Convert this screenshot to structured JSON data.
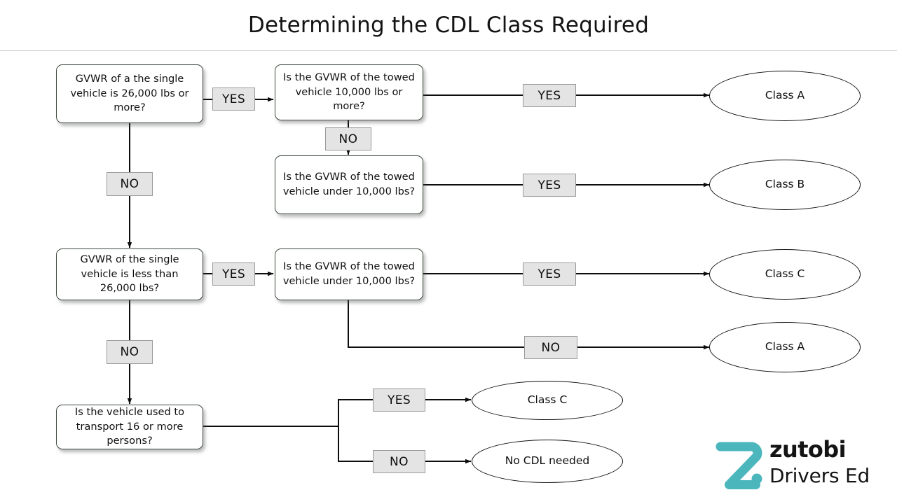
{
  "page": {
    "title": "Determining the CDL Class Required"
  },
  "nodes": {
    "q1": "GVWR of a the single vehicle is 26,000 lbs or more?",
    "q2": "Is the GVWR of the towed vehicle 10,000 lbs or more?",
    "q3": "Is the GVWR of the towed vehicle under 10,000 lbs?",
    "q4": "GVWR of the single vehicle is less than 26,000 lbs?",
    "q5": "Is the GVWR of the towed vehicle under 10,000 lbs?",
    "q6": "Is the vehicle used to transport 16 or more persons?"
  },
  "results": {
    "r1": "Class A",
    "r2": "Class B",
    "r3": "Class C",
    "r4": "Class A",
    "r5": "Class C",
    "r6": "No CDL needed"
  },
  "edges": {
    "yes1": "YES",
    "no1": "NO",
    "yes2": "YES",
    "no2": "NO",
    "yes3": "YES",
    "yes4": "YES",
    "no4": "NO",
    "yes5": "YES",
    "no5": "NO",
    "yes6": "YES",
    "no6": "NO"
  },
  "logo": {
    "mark": "zutobi-z-mark",
    "name": "zutobi",
    "tagline": "Drivers Ed",
    "accent_color": "#4BB6BC"
  },
  "colors": {
    "background": "#ffffff",
    "text": "#111111",
    "node_border": "#3f4a3f",
    "ellipse_border": "#0d0d0d",
    "edge_label_bg": "#e4e4e4",
    "edge_label_border": "#9a9a9a",
    "connector": "#0d0d0d",
    "header_rule": "#c8c8c8"
  }
}
